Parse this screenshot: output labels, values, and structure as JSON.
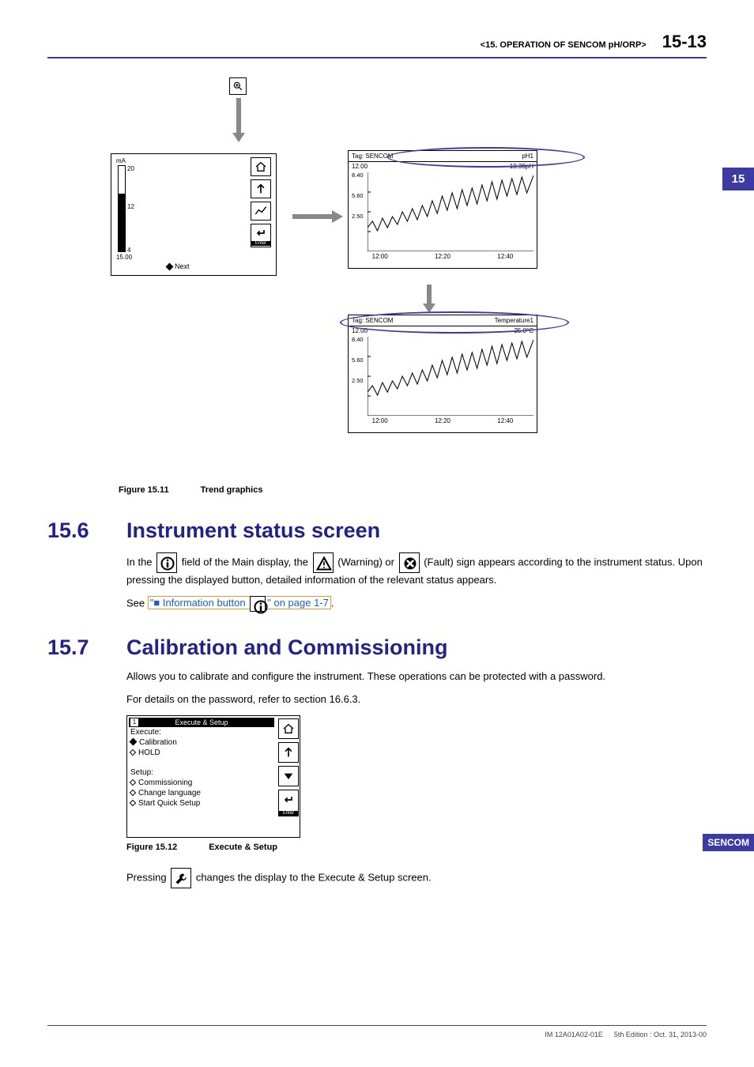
{
  "header": {
    "chapter": "<15.  OPERATION OF SENCOM pH/ORP>",
    "page": "15-13"
  },
  "side_tabs": {
    "num": "15",
    "sencom": "SENCOM"
  },
  "figure11": {
    "caption_label": "Figure 15.11",
    "caption_text": "Trend graphics",
    "gauge": {
      "unit": "mA",
      "ticks": [
        "20",
        "12",
        "4"
      ],
      "value": "15.00",
      "next": "Next",
      "enter": "Enter"
    },
    "trend_top": {
      "tag_label": "Tag:",
      "tag": "SENCOM",
      "type": "pH1",
      "val_left": "12.00",
      "val_right": "10.38pH",
      "ylabels": [
        "8.40",
        "5.60",
        "2.50"
      ],
      "xlabels": [
        "12:00",
        "12:20",
        "12:40"
      ]
    },
    "trend_bot": {
      "tag_label": "Tag:",
      "tag": "SENCOM",
      "type": "Temperature1",
      "val_left": "12.00",
      "val_right": "25.0°C",
      "ylabels": [
        "8.40",
        "5.60",
        "2.50"
      ],
      "xlabels": [
        "12:00",
        "12:20",
        "12:40"
      ]
    }
  },
  "section_156": {
    "num": "15.6",
    "title": "Instrument status screen",
    "para1_a": "In the ",
    "para1_b": " field of the Main display, the ",
    "para1_c": " (Warning) or ",
    "para1_d": " (Fault) sign appears according to the instrument status. Upon pressing the displayed button, detailed information of the relevant status appears.",
    "para2_a": "See ",
    "para2_link": "\"■ Information button ",
    "para2_link_end": "\" on page 1-7",
    "para2_b": "."
  },
  "section_157": {
    "num": "15.7",
    "title": "Calibration and Commissioning",
    "para1": "Allows you to calibrate and configure the instrument. These operations can be protected with a password.",
    "para2": "For details on the password, refer to section 16.6.3.",
    "exec": {
      "header": "Execute & Setup",
      "execute_label": "Execute:",
      "calibration": "Calibration",
      "hold": "HOLD",
      "setup_label": "Setup:",
      "commissioning": "Commissioning",
      "change_language": "Change language",
      "quick_setup": "Start Quick Setup",
      "enter": "Enter"
    },
    "caption_label": "Figure 15.12",
    "caption_text": "Execute & Setup",
    "para3_a": "Pressing ",
    "para3_b": " changes the display to the Execute & Setup screen."
  },
  "footer": {
    "docid": "IM 12A01A02-01E",
    "edition": "5th Edition : Oct. 31, 2013-00"
  },
  "icons": {
    "zoom": "zoom-icon",
    "home": "home-icon",
    "up_arrow": "up-arrow-icon",
    "trend": "trend-icon",
    "enter": "enter-icon",
    "info": "info-icon",
    "warn": "warning-icon",
    "fault": "fault-icon",
    "wrench": "wrench-icon",
    "down_tri": "down-triangle-icon"
  }
}
